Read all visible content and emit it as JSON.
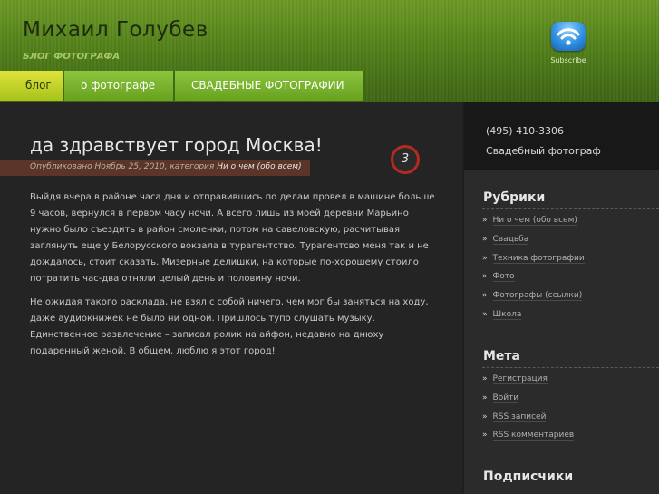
{
  "header": {
    "title": "Михаил Голубев",
    "description": "блог фотографа",
    "subscribe_label": "Subscribe",
    "rss_icon": "rss-icon",
    "accent": "#6c9a25"
  },
  "nav": {
    "items": [
      {
        "label": "блог"
      },
      {
        "label": "о фотографе"
      },
      {
        "label": "СВАДЕБНЫЕ ФОТОГРАФИИ"
      }
    ]
  },
  "post": {
    "title": "да здравствует город Москва!",
    "meta_prefix": "Опубликовано Ноябрь 25, 2010, категория",
    "category": "Ни о чем (обо всем)",
    "comment_count": "3",
    "paragraphs": [
      "Выйдя вчера в районе часа дня и отправившись по делам провел в машине больше 9 часов, вернулся в первом часу ночи. А всего лишь из моей деревни Марьино нужно было съездить в район смоленки, потом на савеловскую, расчитывая заглянуть еще у Белорусского вокзала в турагентство. Турагентсво меня так и не дождалось, стоит сказать. Мизерные делишки, на которые по-хорошему стоило потратить час-два отняли целый день и половину ночи.",
      "Не ожидая такого расклада, не взял с собой ничего, чем мог бы заняться на ходу, даже аудиокнижек не было ни одной. Пришлось тупо слушать музыку. Единственное развлечение – записал ролик на айфон, недавно на днюху подаренный женой. В общем, люблю я этот город!"
    ]
  },
  "sidebar": {
    "phone": "(495) 410-3306",
    "tagline": "Свадебный фотограф",
    "rubrics_title": "Рубрики",
    "rubrics": [
      "Ни о чем (обо всем)",
      "Свадьба",
      "Техника фотографии",
      "Фото",
      "Фотографы (ссылки)",
      "Школа"
    ],
    "meta_title": "Мета",
    "meta_links": [
      "Регистрация",
      "Войти",
      "RSS записей",
      "RSS комментариев"
    ],
    "subscribers_title": "Подписчики"
  }
}
